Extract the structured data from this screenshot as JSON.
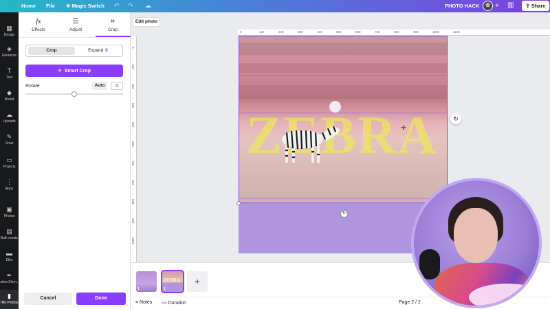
{
  "topbar": {
    "home": "Home",
    "file": "File",
    "magic_switch": "Magic Switch",
    "project_name": "PHOTO HACK",
    "share": "Share"
  },
  "rail": [
    {
      "label": "Design",
      "icon": "▦"
    },
    {
      "label": "Elements",
      "icon": "◈"
    },
    {
      "label": "Text",
      "icon": "T"
    },
    {
      "label": "Brand",
      "icon": "◆"
    },
    {
      "label": "Uploads",
      "icon": "☁"
    },
    {
      "label": "Draw",
      "icon": "✎"
    },
    {
      "label": "Projects",
      "icon": "▭"
    },
    {
      "label": "Apps",
      "icon": "⋮"
    },
    {
      "label": "Photos",
      "icon": "▣"
    },
    {
      "label": "Bulk create",
      "icon": "▤"
    },
    {
      "label": "Elite",
      "icon": "▬"
    },
    {
      "label": "ative Elem..",
      "icon": "✒"
    },
    {
      "label": "rfile Photos",
      "icon": "▮"
    }
  ],
  "panel": {
    "tabs": [
      {
        "label": "Effects",
        "icon": "fx"
      },
      {
        "label": "Adjust",
        "icon": "☰"
      },
      {
        "label": "Crop",
        "icon": "⌗"
      }
    ],
    "segment": {
      "crop": "Crop",
      "expand": "Expand"
    },
    "smart_crop": "Smart Crop",
    "rotate_label": "Rotate",
    "rotate_auto": "Auto",
    "rotate_value": "0",
    "cancel": "Cancel",
    "done": "Done"
  },
  "canvas": {
    "edit_photo": "Edit photo",
    "design_text": "ZEBRA",
    "ruler_top": [
      "0",
      "100",
      "200",
      "300",
      "400",
      "500",
      "600",
      "700",
      "800",
      "900",
      "1000",
      "1100"
    ],
    "ruler_left": [
      "0",
      "100",
      "200",
      "300",
      "400",
      "500",
      "600",
      "700",
      "800",
      "900",
      "1000"
    ]
  },
  "pages": {
    "thumbs": [
      {
        "num": "1",
        "word": ""
      },
      {
        "num": "2",
        "word": "ZEBRA"
      }
    ],
    "add": "+"
  },
  "bottombar": {
    "notes": "Notes",
    "duration": "Duration",
    "page": "Page 2 / 2"
  },
  "colors": {
    "accent": "#8b3dff",
    "rail_bg": "#18191b",
    "purple_block": "#ae95dc"
  }
}
